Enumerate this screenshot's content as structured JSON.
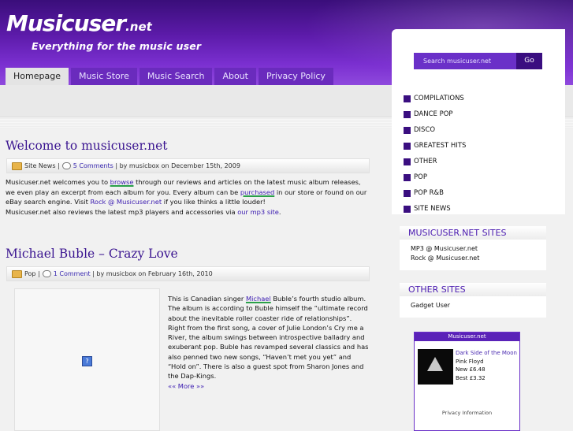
{
  "site": {
    "logo": "Musicuser",
    "logo_net": ".net",
    "tagline": "Everything for the music user"
  },
  "nav": [
    "Homepage",
    "Music Store",
    "Music Search",
    "About",
    "Privacy Policy"
  ],
  "posts": [
    {
      "title": "Welcome to musicuser.net",
      "category": "Site News",
      "comments": "5 Comments",
      "byline": "| by musicbox on December 15th, 2009",
      "p1_a": "Musicuser.net welcomes you to ",
      "p1_link1": "browse",
      "p1_b": " through our reviews and articles on the latest music album releases, we even play an excerpt from each album for you. Every album can be ",
      "p1_link2": "purchased",
      "p1_c": " in our store or found on our eBay search engine. Visit ",
      "p1_link3": "Rock @ Musicuser.net",
      "p1_d": " if you like thinks a little louder!",
      "p2_a": "Musicuser.net also reviews the latest mp3 players and accessories via ",
      "p2_link": "our mp3 site",
      "p2_b": "."
    },
    {
      "title": "Michael Buble – Crazy Love",
      "category": "Pop",
      "comments": "1 Comment",
      "byline": "| by musicbox on February 16th, 2010",
      "t_a": "This is Canadian singer ",
      "t_link": "Michael",
      "t_b": " Buble’s fourth studio album. The album is according to Buble himself the “ultimate record about the inevitable roller coaster ride of relationships”. Right from the first song, a cover of Julie London’s Cry me a River, the album swings between introspective balladry and exuberant pop. Buble has revamped several classics and has also penned two new songs, “Haven’t met you yet” and “Hold on”. There is also a guest spot from Sharon Jones and the Dap-Kings.",
      "more": "«« More »»"
    }
  ],
  "search": {
    "placeholder": "Search musicuser.net",
    "button": "Go"
  },
  "categories": [
    "COMPILATIONS",
    "DANCE POP",
    "DISCO",
    "GREATEST HITS",
    "OTHER",
    "POP",
    "POP R&B",
    "SITE NEWS"
  ],
  "widgets": {
    "sites": {
      "title": "MUSICUSER.NET SITES",
      "links": [
        "MP3 @ Musicuser.net",
        "Rock @ Musicuser.net"
      ]
    },
    "other": {
      "title": "OTHER SITES",
      "links": [
        "Gadget User"
      ]
    }
  },
  "ad": {
    "header": "Musicuser.net",
    "title": "Dark Side of the Moon",
    "artist": "Pink Floyd",
    "new": "New £6.48",
    "best": "Best £3.32",
    "privacy": "Privacy Information"
  }
}
